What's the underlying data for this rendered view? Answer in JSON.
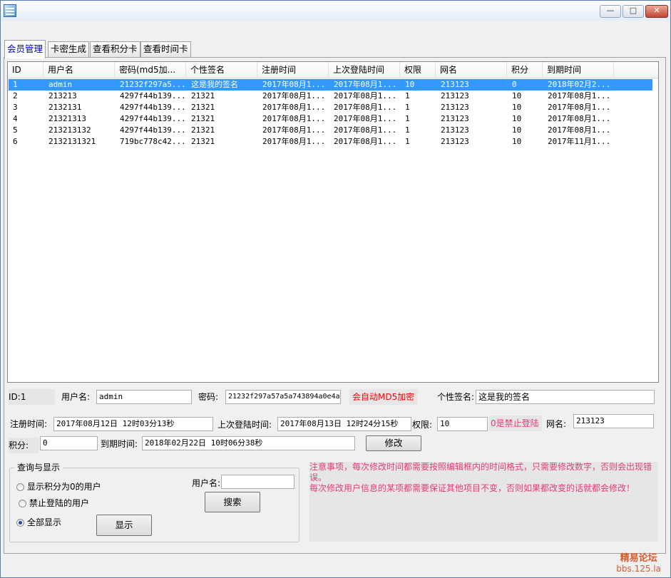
{
  "window": {
    "minimize": "—",
    "maximize": "□",
    "close": "✕"
  },
  "tabs": [
    "会员管理",
    "卡密生成",
    "查看积分卡",
    "查看时间卡"
  ],
  "table": {
    "columns": [
      "ID",
      "用户名",
      "密码(md5加...",
      "个性签名",
      "注册时间",
      "上次登陆时间",
      "权限",
      "网名",
      "积分",
      "到期时间"
    ],
    "rows": [
      [
        "1",
        "admin",
        "21232f297a5...",
        "这是我的签名",
        "2017年08月1...",
        "2017年08月1...",
        "10",
        "213123",
        "0",
        "2018年02月2..."
      ],
      [
        "2",
        "213213",
        "4297f44b139...",
        "21321",
        "2017年08月1...",
        "2017年08月1...",
        "1",
        "213123",
        "10",
        "2017年08月1..."
      ],
      [
        "3",
        "2132131",
        "4297f44b139...",
        "21321",
        "2017年08月1...",
        "2017年08月1...",
        "1",
        "213123",
        "10",
        "2017年08月1..."
      ],
      [
        "4",
        "21321313",
        "4297f44b139...",
        "21321",
        "2017年08月1...",
        "2017年08月1...",
        "1",
        "213123",
        "10",
        "2017年08月1..."
      ],
      [
        "5",
        "213213132",
        "4297f44b139...",
        "21321",
        "2017年08月1...",
        "2017年08月1...",
        "1",
        "213123",
        "10",
        "2017年08月1..."
      ],
      [
        "6",
        "2132131321",
        "719bc778c42...",
        "21321",
        "2017年08月1...",
        "2017年08月1...",
        "1",
        "213123",
        "10",
        "2017年11月1..."
      ]
    ],
    "selected_row": 0
  },
  "form": {
    "id_label": "ID:",
    "id_value": "1",
    "username_label": "用户名:",
    "username_value": "admin",
    "password_label": "密码:",
    "password_value": "21232f297a57a5a743894a0e4a",
    "md5_note": "会自动MD5加密",
    "signature_label": "个性签名:",
    "signature_value": "这是我的签名",
    "reg_time_label": "注册时间:",
    "reg_time_value": "2017年08月12日 12时03分13秒",
    "last_login_label": "上次登陆时间:",
    "last_login_value": "2017年08月13日 12时24分15秒",
    "permission_label": "权限:",
    "permission_value": "10",
    "permission_note": "0是禁止登陆",
    "nickname_label": "网名:",
    "nickname_value": "213123",
    "points_label": "积分:",
    "points_value": "0",
    "expire_label": "到期时间:",
    "expire_value": "2018年02月22日 10时06分38秒",
    "modify_button": "修改"
  },
  "query": {
    "title": "查询与显示",
    "radio_zero_points": "显示积分为0的用户",
    "radio_banned": "禁止登陆的用户",
    "radio_all": "全部显示",
    "selected": "全部显示",
    "username_label": "用户名:",
    "username_value": "",
    "search_button": "搜索",
    "show_button": "显示"
  },
  "notice": {
    "line1": "注意事项，每次修改时间都需要按照编辑框内的时间格式，只需要修改数字，否则会出现错误。",
    "line2": "每次修改用户信息的某项都需要保证其他项目不变，否则如果都改变的话就都会修改！"
  },
  "watermark": {
    "name": "精易论坛",
    "url": "bbs.125.la"
  },
  "colors": {
    "selection": "#3399ff",
    "warning_red": "#ff0000",
    "notice_pink": "#e63b78",
    "tab_active_text": "#0000cc"
  }
}
